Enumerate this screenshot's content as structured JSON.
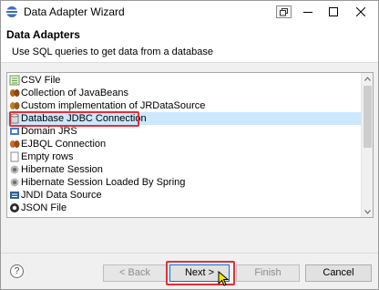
{
  "window": {
    "title": "Data Adapter Wizard"
  },
  "header": {
    "title": "Data Adapters",
    "description": "Use SQL queries to get data from a database"
  },
  "adapters": {
    "items": [
      {
        "label": "CSV File",
        "icon": "csv-file-icon"
      },
      {
        "label": "Collection of JavaBeans",
        "icon": "beans-icon"
      },
      {
        "label": "Custom implementation of JRDataSource",
        "icon": "custom-datasource-icon"
      },
      {
        "label": "Database JDBC Connection",
        "icon": "database-icon",
        "selected": true
      },
      {
        "label": "Domain JRS",
        "icon": "domain-icon"
      },
      {
        "label": "EJBQL Connection",
        "icon": "ejbql-icon"
      },
      {
        "label": "Empty rows",
        "icon": "empty-rows-icon"
      },
      {
        "label": "Hibernate Session",
        "icon": "hibernate-icon"
      },
      {
        "label": "Hibernate Session Loaded By Spring",
        "icon": "hibernate-spring-icon"
      },
      {
        "label": "JNDI Data Source",
        "icon": "jndi-icon"
      },
      {
        "label": "JSON File",
        "icon": "json-file-icon"
      }
    ]
  },
  "footer": {
    "help_label": "?",
    "back_label": "< Back",
    "next_label": "Next >",
    "finish_label": "Finish",
    "cancel_label": "Cancel"
  },
  "colors": {
    "selection": "#cce8ff",
    "annotation_red": "#e0303a",
    "default_button_border": "#0078d7"
  }
}
